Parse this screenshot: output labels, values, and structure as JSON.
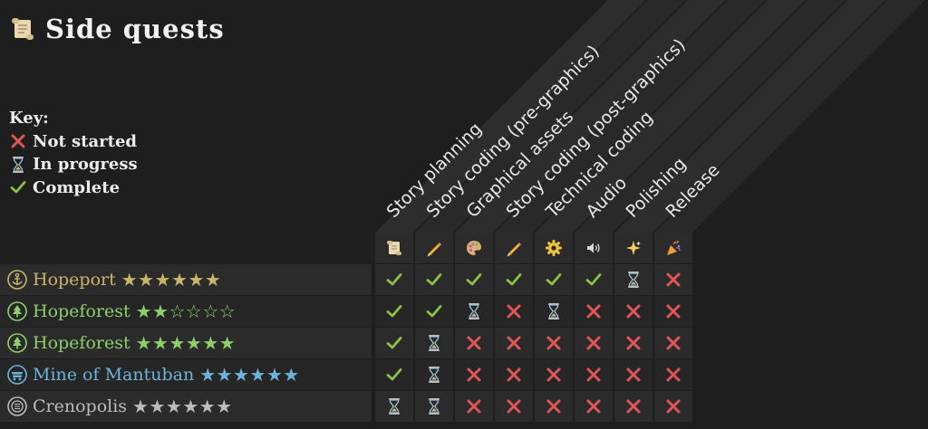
{
  "title": "Side quests",
  "key": {
    "heading": "Key:",
    "items": [
      {
        "status": "not_started",
        "label": "Not started"
      },
      {
        "status": "in_progress",
        "label": "In progress"
      },
      {
        "status": "complete",
        "label": "Complete"
      }
    ]
  },
  "colors": {
    "complete": "#8bc34a",
    "not_started": "#e05555",
    "gold": "#c9b56a",
    "green": "#8dcf6a",
    "blue": "#6cb4d9",
    "grey": "#bcbcbc"
  },
  "columns": [
    {
      "label": "Story planning",
      "icon": "scroll-icon"
    },
    {
      "label": "Story coding (pre-graphics)",
      "icon": "pencil-icon"
    },
    {
      "label": "Graphical assets",
      "icon": "palette-icon"
    },
    {
      "label": "Story coding (post-graphics)",
      "icon": "pencil-icon"
    },
    {
      "label": "Technical coding",
      "icon": "gear-icon"
    },
    {
      "label": "Audio",
      "icon": "speaker-icon"
    },
    {
      "label": "Polishing",
      "icon": "sparkle-icon"
    },
    {
      "label": "Release",
      "icon": "party-popper-icon"
    }
  ],
  "rows": [
    {
      "name": "Hopeport",
      "icon": "anchor-icon",
      "color": "gold",
      "rating": 6,
      "max_rating": 6,
      "statuses": [
        "complete",
        "complete",
        "complete",
        "complete",
        "complete",
        "complete",
        "in_progress",
        "not_started"
      ]
    },
    {
      "name": "Hopeforest",
      "icon": "tree-icon",
      "color": "green",
      "rating": 2,
      "max_rating": 6,
      "statuses": [
        "complete",
        "complete",
        "in_progress",
        "not_started",
        "in_progress",
        "not_started",
        "not_started",
        "not_started"
      ]
    },
    {
      "name": "Hopeforest",
      "icon": "tree-icon",
      "color": "green",
      "rating": 6,
      "max_rating": 6,
      "statuses": [
        "complete",
        "in_progress",
        "not_started",
        "not_started",
        "not_started",
        "not_started",
        "not_started",
        "not_started"
      ]
    },
    {
      "name": "Mine of Mantuban",
      "icon": "minecart-icon",
      "color": "blue",
      "rating": 6,
      "max_rating": 6,
      "statuses": [
        "complete",
        "in_progress",
        "not_started",
        "not_started",
        "not_started",
        "not_started",
        "not_started",
        "not_started"
      ]
    },
    {
      "name": "Crenopolis",
      "icon": "coin-icon",
      "color": "grey",
      "rating": 6,
      "max_rating": 6,
      "statuses": [
        "in_progress",
        "in_progress",
        "not_started",
        "not_started",
        "not_started",
        "not_started",
        "not_started",
        "not_started"
      ]
    }
  ]
}
